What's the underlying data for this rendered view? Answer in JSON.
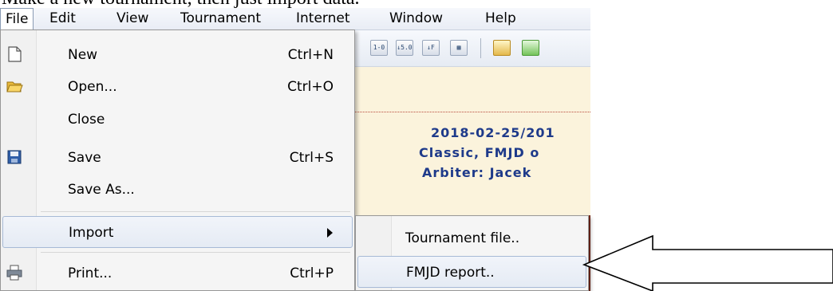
{
  "caption": "Make a new tournament, then just import data.",
  "menubar": {
    "items": [
      "File",
      "Edit",
      "View",
      "Tournament",
      "Internet",
      "Window",
      "Help"
    ]
  },
  "toolbar": {
    "icons": [
      "sort-icon",
      "sort-score-icon",
      "sort-f-icon",
      "table-icon",
      "folder-icon",
      "refresh-icon"
    ],
    "icon_texts": [
      "1-0",
      "↓5.0",
      "↓F",
      "▦"
    ]
  },
  "header": {
    "line1": "2018-02-25/201",
    "line2": "Classic, FMJD o",
    "line3": "Arbiter: Jacek"
  },
  "file_menu": {
    "items": [
      {
        "label": "New",
        "shortcut": "Ctrl+N",
        "icon": "new-file-icon"
      },
      {
        "label": "Open...",
        "shortcut": "Ctrl+O",
        "icon": "open-folder-icon"
      },
      {
        "label": "Close",
        "shortcut": ""
      },
      {
        "label": "Save",
        "shortcut": "Ctrl+S",
        "icon": "save-disk-icon"
      },
      {
        "label": "Save As...",
        "shortcut": ""
      },
      {
        "label": "Import",
        "shortcut": "",
        "submenu": true
      },
      {
        "label": "Print...",
        "shortcut": "Ctrl+P",
        "icon": "printer-icon"
      }
    ]
  },
  "import_submenu": {
    "items": [
      "Tournament file..",
      "FMJD report.."
    ],
    "highlighted": "FMJD report.."
  },
  "colors": {
    "header_text": "#1e3a8a",
    "header_bg": "#fbf3dc",
    "highlight_border": "#a7bad6"
  }
}
